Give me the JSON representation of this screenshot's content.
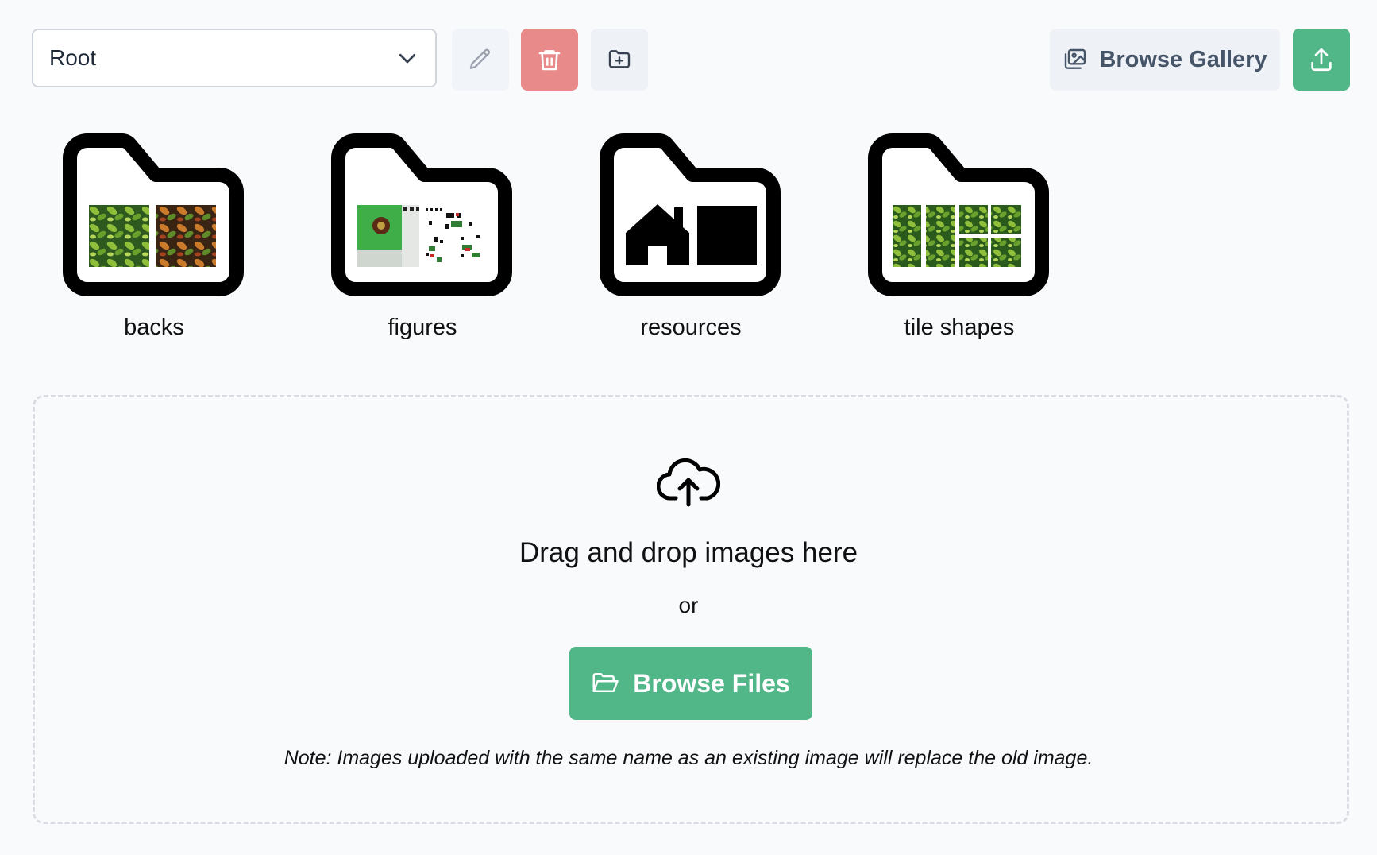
{
  "toolbar": {
    "folder_select_value": "Root",
    "browse_gallery_label": "Browse Gallery",
    "icons": {
      "rename": "pencil-icon",
      "delete": "trash-icon",
      "new_folder": "folder-plus-icon",
      "gallery": "images-icon",
      "upload": "upload-icon",
      "select": "chevron-down-icon"
    },
    "colors": {
      "delete_bg": "#e88a8a",
      "upload_bg": "#52b788",
      "gallery_text": "#475569"
    }
  },
  "folders": [
    {
      "name": "backs",
      "icon": "folder-icon",
      "preview": "image-thumbnails"
    },
    {
      "name": "figures",
      "icon": "folder-icon",
      "preview": "image-thumbnails"
    },
    {
      "name": "resources",
      "icon": "folder-icon",
      "preview": "house-and-square-icon"
    },
    {
      "name": "tile shapes",
      "icon": "folder-icon",
      "preview": "image-thumbnails"
    }
  ],
  "dropzone": {
    "icon": "cloud-upload-icon",
    "title": "Drag and drop images here",
    "or_text": "or",
    "browse_files_label": "Browse Files",
    "browse_files_icon": "folder-open-icon",
    "note": "Note: Images uploaded with the same name as an existing image will replace the old image."
  },
  "accent_color": "#52b788"
}
